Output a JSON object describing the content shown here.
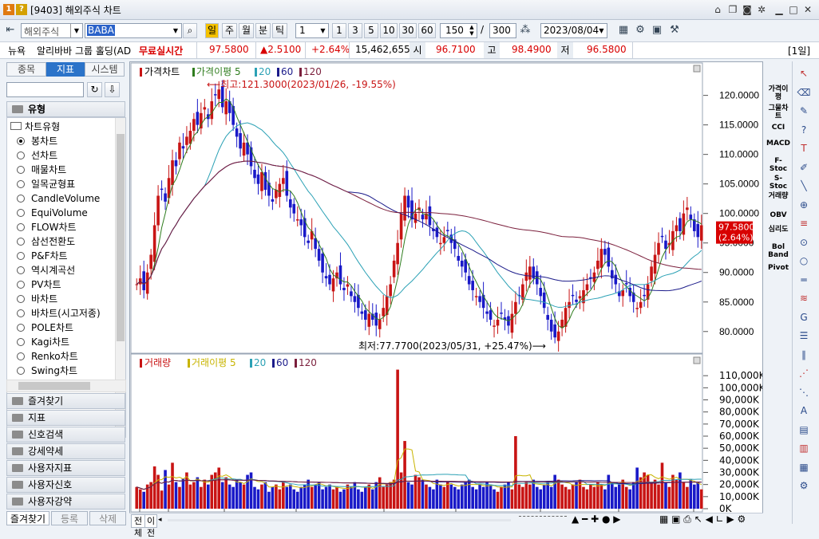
{
  "window": {
    "title": "[9403] 해외주식 차트",
    "icons": [
      "pin-icon",
      "copy-icon",
      "print-icon",
      "camera-icon",
      "settings-icon"
    ],
    "controls": [
      "minimize-icon",
      "maximize-icon",
      "close-icon"
    ]
  },
  "toolbar": {
    "market": "해외주식",
    "symbol": "BABA",
    "periods": [
      "일",
      "주",
      "월",
      "분",
      "틱"
    ],
    "selected_period": "일",
    "interval_value": "1",
    "quick_intervals": [
      "1",
      "3",
      "5",
      "10",
      "30",
      "60"
    ],
    "view_count": "150",
    "separator": "/",
    "total_count": "300",
    "date": "2023/08/04"
  },
  "quote": {
    "exchange": "뉴욕",
    "name": "알리바바 그룹 홀딩(AD",
    "realtime_label": "무료실시간",
    "price": "97.5800",
    "change": "▲2.5100",
    "change_pct": "+2.64%",
    "volume": "15,462,655",
    "open_label": "시",
    "open": "96.7100",
    "high_label": "고",
    "high": "98.4900",
    "low_label": "저",
    "low": "96.5800",
    "unit": "[1일]",
    "up_color": "#d80000"
  },
  "left_panel": {
    "tabs": [
      "종목",
      "지표",
      "시스템"
    ],
    "active_tab": "지표",
    "type_header": "유형",
    "group_header": "차트유형",
    "chart_types": [
      "봉차트",
      "선차트",
      "매물차트",
      "일목균형표",
      "CandleVolume",
      "EquiVolume",
      "FLOW차트",
      "삼선전환도",
      "P&F차트",
      "역시계곡선",
      "PV차트",
      "바차트",
      "바차트(시고저종)",
      "POLE차트",
      "Kagi차트",
      "Renko차트",
      "Swing차트"
    ],
    "selected_type": "봉차트",
    "sections": [
      "즐겨찾기",
      "지표",
      "신호검색",
      "강세약세",
      "사용자지표",
      "사용자신호",
      "사용자강약"
    ],
    "bottom_tabs": [
      "즐겨찾기",
      "등록",
      "삭제"
    ]
  },
  "chart_data": [
    {
      "type": "candlestick",
      "title": "가격차트",
      "legend": [
        "가격이평 5",
        "20",
        "60",
        "120"
      ],
      "legend_colors": [
        "#2f7d1e",
        "#2ba1b5",
        "#1b1b8a",
        "#7b1f3c"
      ],
      "ylim": [
        77,
        124
      ],
      "y_ticks": [
        "120.0000",
        "115.0000",
        "110.0000",
        "105.0000",
        "100.0000",
        "95.0000",
        "90.0000",
        "85.0000",
        "80.0000"
      ],
      "x_ticks": [
        "12",
        "2023/01",
        "02",
        "03",
        "04",
        "05",
        "06",
        "07",
        "08"
      ],
      "annotations": {
        "high": "최고:121.3000(2023/01/26, -19.55%)",
        "low": "최저:77.7700(2023/05/31, +25.47%)"
      },
      "last_price": "97.5800",
      "last_change": "(2.64%)",
      "close": [
        88,
        89,
        87,
        90,
        93,
        98,
        103,
        104,
        102,
        106,
        109,
        108,
        112,
        111,
        113,
        114,
        116,
        115,
        117,
        118,
        116,
        119,
        120,
        121,
        118,
        119,
        117,
        115,
        113,
        111,
        112,
        110,
        108,
        106,
        105,
        107,
        104,
        103,
        102,
        104,
        105,
        106,
        103,
        101,
        100,
        99,
        98,
        96,
        95,
        97,
        94,
        92,
        90,
        89,
        88,
        89,
        90,
        88,
        87,
        88,
        86,
        85,
        84,
        83,
        82,
        83,
        82,
        81,
        82,
        84,
        86,
        88,
        92,
        95,
        100,
        103,
        101,
        99,
        100,
        101,
        99,
        100,
        98,
        97,
        96,
        95,
        96,
        97,
        95,
        94,
        92,
        91,
        90,
        88,
        87,
        86,
        85,
        84,
        83,
        82,
        81,
        82,
        83,
        82,
        81,
        83,
        85,
        86,
        88,
        90,
        91,
        89,
        88,
        86,
        84,
        82,
        80,
        79,
        80,
        82,
        84,
        85,
        86,
        85,
        86,
        87,
        88,
        89,
        90,
        92,
        94,
        93,
        91,
        89,
        88,
        86,
        87,
        88,
        86,
        85,
        84,
        85,
        86,
        88,
        91,
        93,
        95,
        96,
        94,
        95,
        97,
        98,
        97,
        100,
        101,
        99,
        97,
        96,
        98
      ],
      "y_axis_label_note": ""
    },
    {
      "type": "bar",
      "title": "거래량",
      "legend": [
        "거래이평 5",
        "20",
        "60",
        "120"
      ],
      "legend_colors": [
        "#c8b400",
        "#2ba1b5",
        "#1b1b8a",
        "#7b1f3c"
      ],
      "ylim": [
        0,
        120000
      ],
      "y_ticks": [
        "110,000K",
        "100,000K",
        "90,000K",
        "80,000K",
        "70,000K",
        "60,000K",
        "50,000K",
        "40,000K",
        "30,000K",
        "20,000K",
        "10,000K",
        "0K"
      ],
      "values_k": [
        18,
        16,
        14,
        20,
        22,
        35,
        28,
        15,
        32,
        20,
        38,
        22,
        18,
        25,
        30,
        20,
        22,
        26,
        18,
        24,
        20,
        28,
        30,
        34,
        22,
        26,
        20,
        18,
        24,
        22,
        20,
        28,
        30,
        18,
        16,
        20,
        22,
        14,
        18,
        20,
        16,
        22,
        18,
        20,
        16,
        14,
        18,
        20,
        24,
        18,
        20,
        22,
        16,
        18,
        20,
        16,
        18,
        14,
        16,
        20,
        18,
        22,
        16,
        14,
        18,
        20,
        16,
        22,
        26,
        18,
        20,
        22,
        24,
        115,
        30,
        56,
        22,
        20,
        28,
        26,
        24,
        20,
        18,
        16,
        24,
        20,
        18,
        22,
        20,
        18,
        16,
        20,
        22,
        24,
        18,
        16,
        20,
        18,
        22,
        20,
        16,
        14,
        18,
        20,
        22,
        16,
        60,
        20,
        18,
        22,
        20,
        24,
        18,
        16,
        20,
        22,
        18,
        28,
        24,
        20,
        18,
        16,
        20,
        22,
        24,
        18,
        16,
        20,
        18,
        22,
        20,
        16,
        28,
        22,
        18,
        20,
        24,
        18,
        16,
        22,
        34,
        26,
        30,
        28,
        22,
        24,
        20,
        38,
        22,
        18,
        28,
        24,
        30,
        22,
        18,
        24,
        20,
        22,
        16,
        18
      ],
      "up_color": "#c81414",
      "down_color": "#1919c8"
    }
  ],
  "right_panel": {
    "indicators": [
      "가격이평",
      "그물차트",
      "CCI",
      "MACD",
      "F-Stoc",
      "S-Stoc",
      "거래량",
      "OBV",
      "심리도",
      "Bol Band",
      "Pivot"
    ],
    "tools": [
      "cursor-icon",
      "eraser-icon",
      "chart-pen-icon",
      "help-icon",
      "text-icon",
      "line-icon",
      "diagonal-icon",
      "crosshair-icon",
      "fib-icon",
      "trend-icon",
      "circle-icon",
      "horizontal-icon",
      "zigzag-icon",
      "gann-icon",
      "parallel-icon",
      "channel-icon",
      "fan-icon",
      "auto-icon",
      "list-icon",
      "doc-icon",
      "stats-icon",
      "more-icon",
      "settings-icon"
    ]
  },
  "bottom_bar": {
    "buttons": [
      "전체",
      "이전"
    ],
    "icons": [
      "zoom-out-icon",
      "zoom-in-icon",
      "stop-icon",
      "right-icon",
      "play-icon",
      "excel-icon",
      "save-icon",
      "print-icon",
      "cursor-icon",
      "left-nav-icon",
      "line-nav-icon",
      "right-nav-icon",
      "settings-icon"
    ]
  }
}
